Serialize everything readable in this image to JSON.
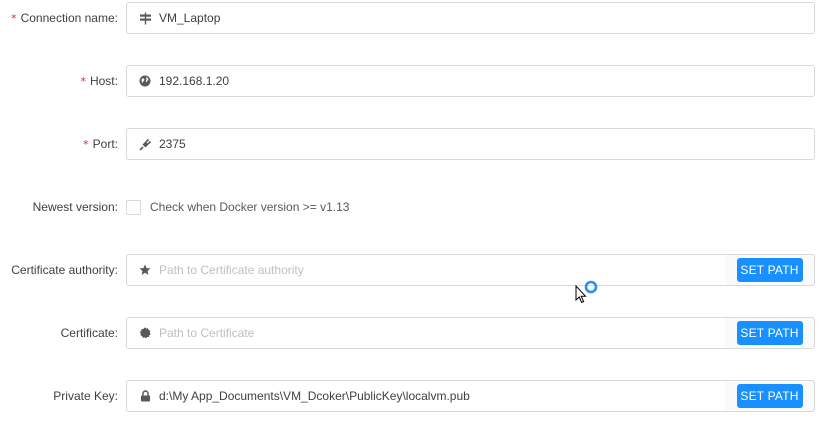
{
  "form": {
    "connection_name": {
      "label": "Connection name",
      "required": true,
      "icon": "signpost-icon",
      "value": "VM_Laptop"
    },
    "host": {
      "label": "Host",
      "required": true,
      "icon": "globe-icon",
      "value": "192.168.1.20"
    },
    "port": {
      "label": "Port",
      "required": true,
      "icon": "plug-icon",
      "value": "2375"
    },
    "newest_version": {
      "label": "Newest version",
      "checkbox_label": "Check when Docker version >= v1.13",
      "checked": false
    },
    "certificate_authority": {
      "label": "Certificate authority",
      "icon": "star-icon",
      "placeholder": "Path to Certificate authority",
      "value": "",
      "button": "SET PATH"
    },
    "certificate": {
      "label": "Certificate",
      "icon": "certificate-icon",
      "placeholder": "Path to Certificate",
      "value": "",
      "button": "SET PATH"
    },
    "private_key": {
      "label": "Private Key",
      "icon": "lock-icon",
      "value": "d:\\My App_Documents\\VM_Dcoker\\PublicKey\\localvm.pub",
      "button": "SET PATH"
    }
  },
  "colors": {
    "primary": "#1890ff",
    "required": "#f5222d",
    "border": "#d9d9d9",
    "placeholder": "#bfbfbf"
  },
  "label_suffix": ":",
  "required_marker": "*"
}
